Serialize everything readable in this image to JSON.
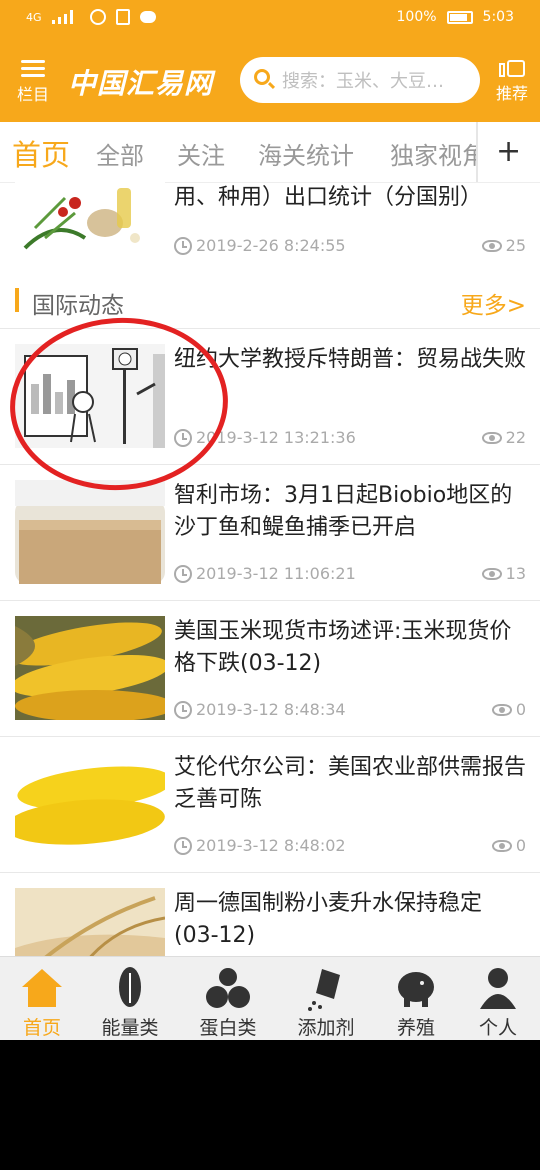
{
  "status_bar": {
    "network": "4G",
    "battery": "100%",
    "time": "5:03"
  },
  "header": {
    "menu_label": "栏目",
    "logo": "中国汇易网",
    "search_placeholder": "搜索：玉米、大豆…",
    "recommend_label": "推荐",
    "brand_color": "#f7a81b"
  },
  "tabs": [
    {
      "label": "首页",
      "active": true
    },
    {
      "label": "全部"
    },
    {
      "label": "关注"
    },
    {
      "label": "海关统计"
    },
    {
      "label": "独家视角"
    }
  ],
  "tabs_more": "+",
  "partial_item": {
    "title": "用、种用）出口统计（分国别）",
    "time": "2019-2-26 8:24:55",
    "views": "25"
  },
  "section": {
    "name": "国际动态",
    "more": "更多>"
  },
  "articles": [
    {
      "title": "纽约大学教授斥特朗普：贸易战失败",
      "time": "2019-3-12 13:21:36",
      "views": "22",
      "image": "cartoon-illustration",
      "annotated": true
    },
    {
      "title": "智利市场：3月1日起Biobio地区的沙丁鱼和鳀鱼捕季已开启",
      "time": "2019-3-12 11:06:21",
      "views": "13",
      "image": "fishmeal-jar"
    },
    {
      "title": "美国玉米现货市场述评:玉米现货价格下跌(03-12)",
      "time": "2019-3-12 8:48:34",
      "views": "0",
      "image": "corn-cobs"
    },
    {
      "title": "艾伦代尔公司：美国农业部供需报告乏善可陈",
      "time": "2019-3-12 8:48:02",
      "views": "0",
      "image": "corn-cobs"
    },
    {
      "title": "周一德国制粉小麦升水保持稳定(03-12)",
      "time": "",
      "views": "",
      "image": "wheat-hand"
    }
  ],
  "bottom_nav": [
    {
      "label": "首页",
      "icon": "home-icon",
      "active": true
    },
    {
      "label": "能量类",
      "icon": "corn-icon"
    },
    {
      "label": "蛋白类",
      "icon": "beans-icon"
    },
    {
      "label": "添加剂",
      "icon": "additive-icon"
    },
    {
      "label": "养殖",
      "icon": "pig-icon"
    },
    {
      "label": "个人",
      "icon": "person-icon"
    }
  ]
}
